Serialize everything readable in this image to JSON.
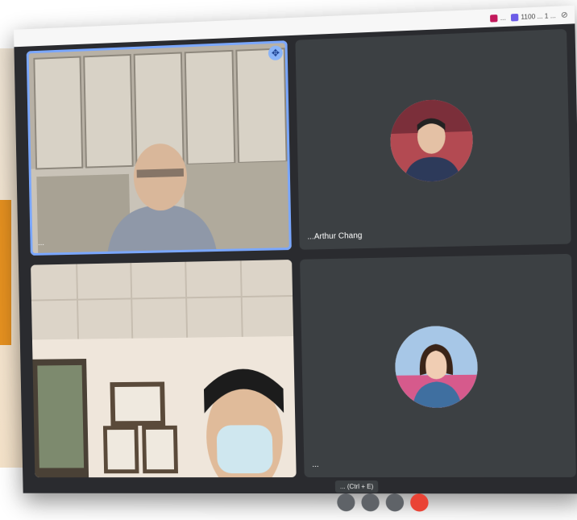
{
  "bookmarks": [
    {
      "label": "... ",
      "icon": "bookmark-icon",
      "color": "#c2185b"
    },
    {
      "label": "1100 ... 1 ...",
      "icon": "bookmark-icon",
      "color": "#6c5ce7"
    }
  ],
  "participants": [
    {
      "name": "...",
      "pinned": true
    },
    {
      "name": "...Arthur Chang"
    },
    {
      "name": ""
    },
    {
      "name": "..."
    }
  ],
  "toolbar": {
    "tooltip": "... (Ctrl + E)"
  },
  "colors": {
    "tile_bg": "#3c4043",
    "active_outline": "#7aa7ff",
    "accent": "#e5901f",
    "leave": "#ea4335"
  }
}
